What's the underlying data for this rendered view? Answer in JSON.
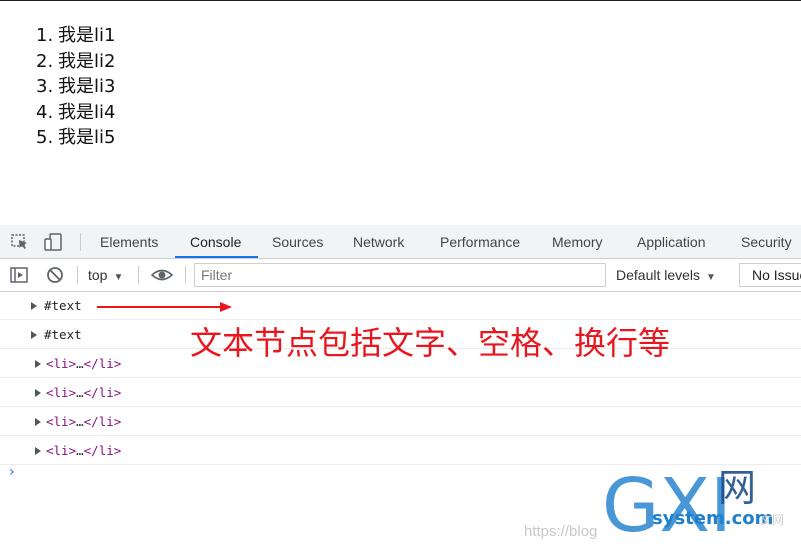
{
  "page": {
    "list_items": [
      {
        "num": "1.",
        "text": "我是li1"
      },
      {
        "num": "2.",
        "text": "我是li2"
      },
      {
        "num": "3.",
        "text": "我是li3"
      },
      {
        "num": "4.",
        "text": "我是li4"
      },
      {
        "num": "5.",
        "text": "我是li5"
      }
    ]
  },
  "devtools": {
    "tabs": [
      "Elements",
      "Console",
      "Sources",
      "Network",
      "Performance",
      "Memory",
      "Application",
      "Security"
    ],
    "active_tab": "Console",
    "toolbar": {
      "context": "top",
      "filter_placeholder": "Filter",
      "levels": "Default levels",
      "issues": "No Issues"
    },
    "console_rows": [
      {
        "type": "text",
        "label": "#text"
      },
      {
        "type": "text",
        "label": "#text"
      },
      {
        "type": "element",
        "open": "<li>",
        "ellipsis": "…",
        "close": "</li>"
      },
      {
        "type": "element",
        "open": "<li>",
        "ellipsis": "…",
        "close": "</li>"
      },
      {
        "type": "element",
        "open": "<li>",
        "ellipsis": "…",
        "close": "</li>"
      },
      {
        "type": "element",
        "open": "<li>",
        "ellipsis": "…",
        "close": "</li>"
      }
    ],
    "prompt": "›"
  },
  "annotation": {
    "text": "文本节点包括文字、空格、换行等",
    "color": "#e8171e"
  },
  "watermark": {
    "logo_letters": "GXI",
    "logo_cn": "网",
    "site": "system.com",
    "url": "https://blog",
    "cn_small": "文网"
  },
  "colors": {
    "accent": "#1a73e8",
    "tag": "#881280",
    "annotation": "#e8171e"
  }
}
